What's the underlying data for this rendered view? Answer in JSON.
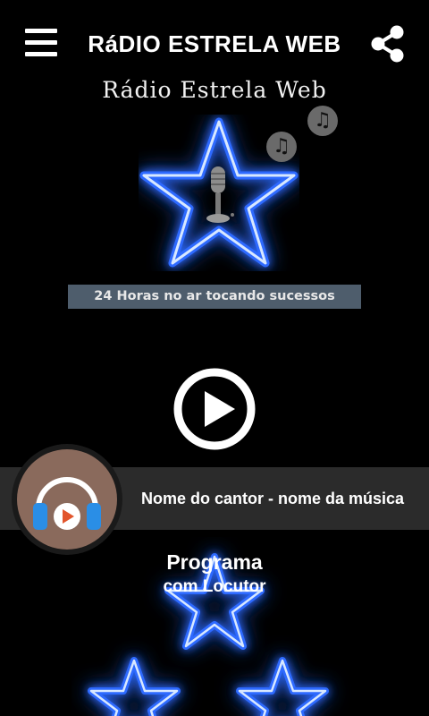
{
  "header": {
    "title": "RáDIO ESTRELA WEB",
    "menu_icon": "hamburger-menu-icon",
    "share_icon": "share-icon"
  },
  "logo": {
    "text": "Rádio Estrela Web",
    "tagline": "24 Horas no ar tocando sucessos",
    "icons": [
      "star-icon",
      "microphone-icon",
      "music-note-icon"
    ],
    "note_glyph": "♫"
  },
  "player": {
    "play_icon": "play-icon",
    "now_playing": "Nome do cantor - nome da música",
    "cover_icon": "headphones-icon"
  },
  "program": {
    "title": "Programa",
    "host": "com Locutor"
  },
  "colors": {
    "background": "#000000",
    "neon_blue": "#2f6bff",
    "neon_core": "#d8e8ff",
    "bar": "#2b2b2b",
    "tagline_bar": "#4e5d6c",
    "avatar_bg": "#8a6a5c",
    "headphones_blue": "#2a8ee6",
    "play_red": "#e2552c"
  }
}
